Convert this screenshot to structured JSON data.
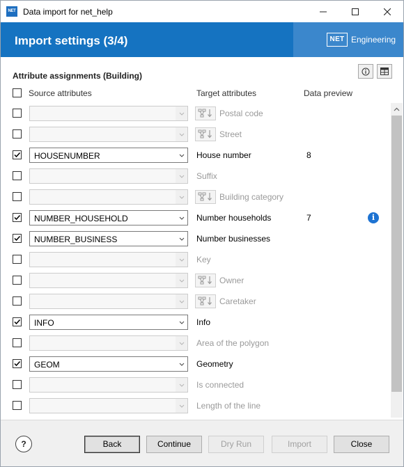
{
  "window": {
    "icon_text": "NET",
    "title": "Data import for net_help"
  },
  "header": {
    "title": "Import settings (3/4)",
    "brand_logo": "NET",
    "brand_text": "Engineering"
  },
  "section": {
    "title": "Attribute assignments (Building)"
  },
  "columns": {
    "source": "Source attributes",
    "target": "Target attributes",
    "preview": "Data preview"
  },
  "rows": [
    {
      "checked": false,
      "source": "",
      "target": "Postal code",
      "enabled": false,
      "map_button": true,
      "preview": ""
    },
    {
      "checked": false,
      "source": "",
      "target": "Street",
      "enabled": false,
      "map_button": true,
      "preview": ""
    },
    {
      "checked": true,
      "source": "HOUSENUMBER",
      "target": "House number",
      "enabled": true,
      "map_button": false,
      "preview": "8"
    },
    {
      "checked": false,
      "source": "",
      "target": "Suffix",
      "enabled": false,
      "map_button": false,
      "preview": ""
    },
    {
      "checked": false,
      "source": "",
      "target": "Building category",
      "enabled": false,
      "map_button": true,
      "preview": ""
    },
    {
      "checked": true,
      "source": "NUMBER_HOUSEHOLD",
      "target": "Number households",
      "enabled": true,
      "map_button": false,
      "preview": "7",
      "info_icon": true
    },
    {
      "checked": true,
      "source": "NUMBER_BUSINESS",
      "target": "Number businesses",
      "enabled": true,
      "map_button": false,
      "preview": ""
    },
    {
      "checked": false,
      "source": "",
      "target": "Key",
      "enabled": false,
      "map_button": false,
      "preview": ""
    },
    {
      "checked": false,
      "source": "",
      "target": "Owner",
      "enabled": false,
      "map_button": true,
      "preview": ""
    },
    {
      "checked": false,
      "source": "",
      "target": "Caretaker",
      "enabled": false,
      "map_button": true,
      "preview": ""
    },
    {
      "checked": true,
      "source": "INFO",
      "target": "Info",
      "enabled": true,
      "map_button": false,
      "preview": ""
    },
    {
      "checked": false,
      "source": "",
      "target": "Area of the polygon",
      "enabled": false,
      "map_button": false,
      "preview": ""
    },
    {
      "checked": true,
      "source": "GEOM",
      "target": "Geometry",
      "enabled": true,
      "map_button": false,
      "preview": ""
    },
    {
      "checked": false,
      "source": "",
      "target": "Is connected",
      "enabled": false,
      "map_button": false,
      "preview": ""
    },
    {
      "checked": false,
      "source": "",
      "target": "Length of the line",
      "enabled": false,
      "map_button": false,
      "preview": ""
    }
  ],
  "footer": {
    "help_label": "?",
    "back_label": "Back",
    "continue_label": "Continue",
    "dryrun_label": "Dry Run",
    "import_label": "Import",
    "close_label": "Close"
  },
  "colors": {
    "header_blue": "#1573c1",
    "brand_blue": "#3b87cc",
    "info_blue": "#1e73d2"
  }
}
